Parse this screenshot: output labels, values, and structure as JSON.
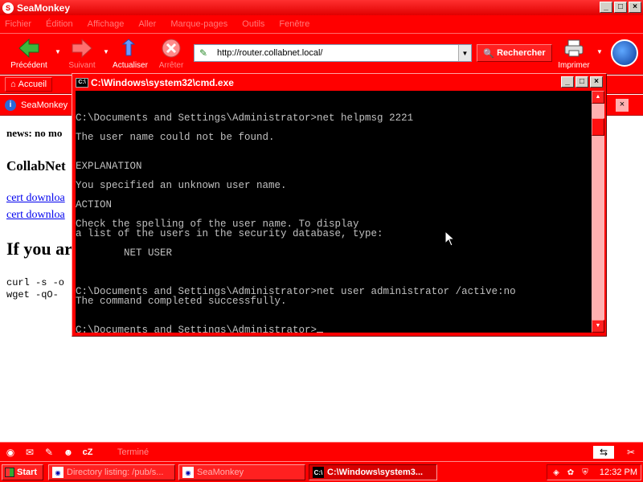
{
  "seamonkey": {
    "title": "SeaMonkey",
    "menu": [
      "Fichier",
      "Édition",
      "Affichage",
      "Aller",
      "Marque-pages",
      "Outils",
      "Fenêtre"
    ],
    "toolbar": {
      "back": "Précédent",
      "forward": "Suivant",
      "reload": "Actualiser",
      "stop": "Arrêter",
      "url": "http://router.collabnet.local/",
      "search": "Rechercher",
      "print": "Imprimer"
    },
    "bookmarks": {
      "home": "Accueil"
    },
    "tab": {
      "title": "SeaMonkey"
    },
    "content": {
      "news": "news: no mo",
      "heading": "CollabNet",
      "link1": "cert downloa",
      "link2": "cert downloa",
      "big": "If you ar",
      "code1": "curl -s -o",
      "code2": "wget -qO-"
    },
    "status": "Terminé"
  },
  "cmd": {
    "title": "C:\\Windows\\system32\\cmd.exe",
    "lines": [
      "",
      "",
      "C:\\Documents and Settings\\Administrator>net helpmsg 2221",
      "",
      "The user name could not be found.",
      "",
      "",
      "EXPLANATION",
      "",
      "You specified an unknown user name.",
      "",
      "ACTION",
      "",
      "Check the spelling of the user name. To display",
      "a list of the users in the security database, type:",
      "",
      "        NET USER",
      "",
      "",
      "",
      "C:\\Documents and Settings\\Administrator>net user administrator /active:no",
      "The command completed successfully.",
      "",
      "",
      "C:\\Documents and Settings\\Administrator>"
    ]
  },
  "taskbar": {
    "start": "Start",
    "tasks": [
      "Directory listing: /pub/s...",
      "SeaMonkey",
      "C:\\Windows\\system3..."
    ],
    "clock": "12:32 PM"
  }
}
